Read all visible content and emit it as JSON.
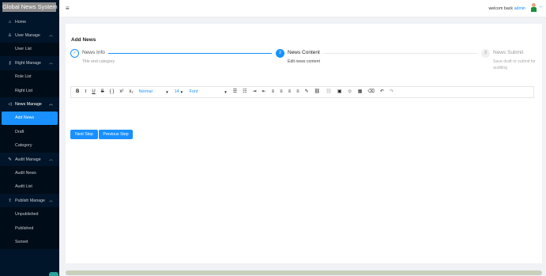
{
  "app": {
    "title": "Global News System"
  },
  "sidebar": {
    "items": [
      {
        "label": "Home",
        "icon": "home-icon",
        "type": "top"
      },
      {
        "label": "User Manage",
        "icon": "user-icon",
        "type": "top",
        "open": true
      },
      {
        "label": "User List",
        "type": "sub"
      },
      {
        "label": "Right Manage",
        "icon": "key-icon",
        "type": "top",
        "open": true
      },
      {
        "label": "Role List",
        "type": "sub"
      },
      {
        "label": "Right List",
        "type": "sub"
      },
      {
        "label": "News Manage",
        "icon": "megaphone-icon",
        "type": "top",
        "open": true
      },
      {
        "label": "Add News",
        "type": "sub",
        "active": true
      },
      {
        "label": "Draft",
        "type": "sub"
      },
      {
        "label": "Category",
        "type": "sub"
      },
      {
        "label": "Audit Manage",
        "icon": "edit-icon",
        "type": "top",
        "open": true
      },
      {
        "label": "Audit News",
        "type": "sub"
      },
      {
        "label": "Audit List",
        "type": "sub"
      },
      {
        "label": "Publish Manage",
        "icon": "upload-icon",
        "type": "top",
        "open": true
      },
      {
        "label": "Unpublished",
        "type": "sub"
      },
      {
        "label": "Published",
        "type": "sub"
      },
      {
        "label": "Sunset",
        "type": "sub"
      }
    ]
  },
  "header": {
    "welcome": "welcom back",
    "username": "admin"
  },
  "page": {
    "title": "Add News"
  },
  "steps": [
    {
      "num": "✓",
      "title": "News Info",
      "desc": "Title and category",
      "status": "finished"
    },
    {
      "num": "2",
      "title": "News Content",
      "desc": "Edit news content",
      "status": "current"
    },
    {
      "num": "3",
      "title": "News Submit",
      "desc": "Save draft or submit for auditing",
      "status": "waiting"
    }
  ],
  "editor": {
    "block_type": "Normal",
    "font_size": "14",
    "font_family": "Font"
  },
  "buttons": {
    "next": "Next Step",
    "previous": "Previous Step"
  },
  "colors": {
    "primary": "#1890ff",
    "sidebar_bg": "#001529",
    "submenu_bg": "#000c17"
  }
}
